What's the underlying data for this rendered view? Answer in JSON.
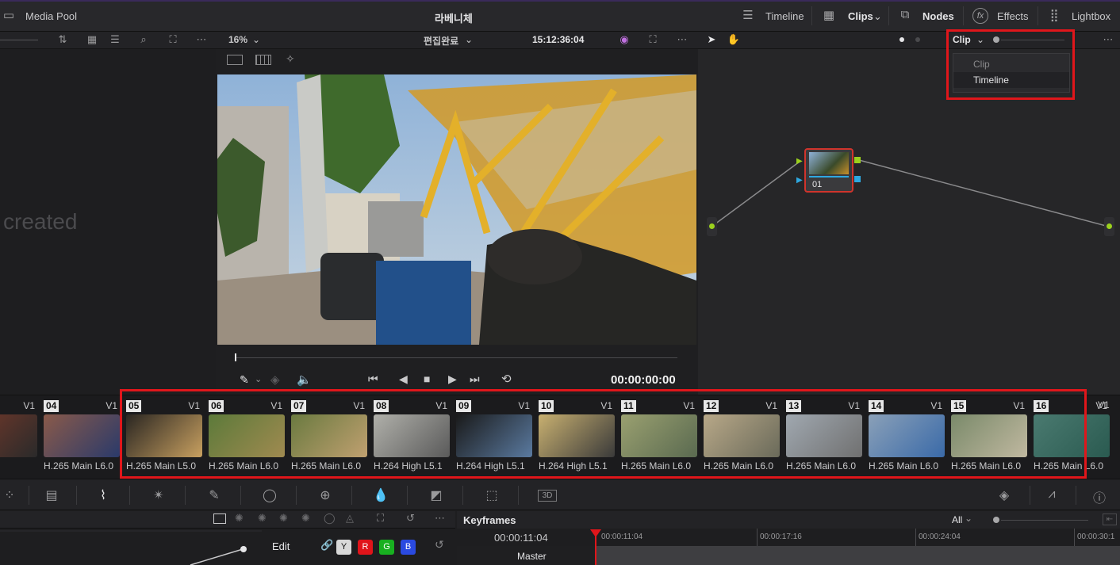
{
  "topbar": {
    "media_pool": "Media Pool",
    "project_title": "라베니체",
    "timeline": "Timeline",
    "clips": "Clips",
    "nodes": "Nodes",
    "effects": "Effects",
    "lightbox": "Lightbox"
  },
  "viewer": {
    "zoom": "16%",
    "timeline_name": "편집완료",
    "timecode_top": "15:12:36:04",
    "timecode_bottom": "00:00:00:00"
  },
  "pool": {
    "empty_text": "created"
  },
  "nodes": {
    "mode_selected": "Clip",
    "dropdown_options": [
      "Clip",
      "Timeline"
    ],
    "node_label": "01"
  },
  "clips": [
    {
      "num": "",
      "track": "V1",
      "codec": "ain L6.0",
      "colors": [
        "#7a3a2a",
        "#2a2a2a"
      ]
    },
    {
      "num": "04",
      "track": "V1",
      "codec": "H.265 Main L6.0",
      "colors": [
        "#8a5a4a",
        "#2a3a6a"
      ]
    },
    {
      "num": "05",
      "track": "V1",
      "codec": "H.265 Main L5.0",
      "colors": [
        "#2a2622",
        "#c8a060"
      ]
    },
    {
      "num": "06",
      "track": "V1",
      "codec": "H.265 Main L6.0",
      "colors": [
        "#5c7a3a",
        "#a08a50"
      ]
    },
    {
      "num": "07",
      "track": "V1",
      "codec": "H.265 Main L6.0",
      "colors": [
        "#6a7a40",
        "#c0a070"
      ]
    },
    {
      "num": "08",
      "track": "V1",
      "codec": "H.264 High L5.1",
      "colors": [
        "#b0b0aa",
        "#5a5a5a"
      ]
    },
    {
      "num": "09",
      "track": "V1",
      "codec": "H.264 High L5.1",
      "colors": [
        "#1a1a1a",
        "#5a7aa0"
      ]
    },
    {
      "num": "10",
      "track": "V1",
      "codec": "H.264 High L5.1",
      "colors": [
        "#c8b070",
        "#3a3a3a"
      ]
    },
    {
      "num": "11",
      "track": "V1",
      "codec": "H.265 Main L6.0",
      "colors": [
        "#9aa070",
        "#5a6a50"
      ]
    },
    {
      "num": "12",
      "track": "V1",
      "codec": "H.265 Main L6.0",
      "colors": [
        "#b8a888",
        "#6a6a5a"
      ]
    },
    {
      "num": "13",
      "track": "V1",
      "codec": "H.265 Main L6.0",
      "colors": [
        "#a0a8b0",
        "#707070"
      ]
    },
    {
      "num": "14",
      "track": "V1",
      "codec": "H.265 Main L6.0",
      "colors": [
        "#8aa0b8",
        "#3a6aa8"
      ]
    },
    {
      "num": "15",
      "track": "V1",
      "codec": "H.265 Main L6.0",
      "colors": [
        "#7a8a6a",
        "#c0b8a0"
      ]
    },
    {
      "num": "16",
      "track": "V1",
      "codec": "H.265 Main L6.0",
      "colors": [
        "#4a7a70",
        "#2a5a50"
      ]
    }
  ],
  "strip_extra_track": "V1",
  "keyframes": {
    "title": "Keyframes",
    "filter": "All",
    "current_time": "00:00:11:04",
    "ruler": [
      "00:00:11:04",
      "00:00:17:16",
      "00:00:24:04",
      "00:00:30:1"
    ],
    "master": "Master"
  },
  "edit": {
    "label": "Edit",
    "channels": [
      "Y",
      "R",
      "G",
      "B"
    ]
  },
  "icons": {
    "accent": "#e0161b",
    "node_green": "#9bd11d",
    "node_blue": "#2ea8e0"
  }
}
